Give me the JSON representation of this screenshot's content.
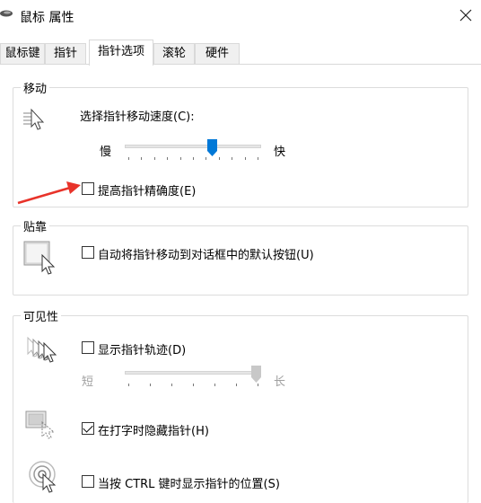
{
  "window": {
    "title": "鼠标 属性"
  },
  "tabs": [
    {
      "label": "鼠标键"
    },
    {
      "label": "指针"
    },
    {
      "label": "指针选项"
    },
    {
      "label": "滚轮"
    },
    {
      "label": "硬件"
    }
  ],
  "motion": {
    "title": "移动",
    "speed_label": "选择指针移动速度(C):",
    "slow": "慢",
    "fast": "快",
    "speed_value": 0.65,
    "precision_label": "提高指针精确度(E)",
    "precision_checked": false
  },
  "snap": {
    "title": "贴靠",
    "snap_label": "自动将指针移动到对话框中的默认按钮(U)",
    "snap_checked": false
  },
  "visibility": {
    "title": "可见性",
    "trails_label": "显示指针轨迹(D)",
    "trails_checked": false,
    "short": "短",
    "long": "长",
    "trails_value": 1.0,
    "hide_label": "在打字时隐藏指针(H)",
    "hide_checked": true,
    "ctrl_label": "当按 CTRL 键时显示指针的位置(S)",
    "ctrl_checked": false
  },
  "colors": {
    "accent": "#0078d7",
    "annotation": "#e8332a"
  }
}
